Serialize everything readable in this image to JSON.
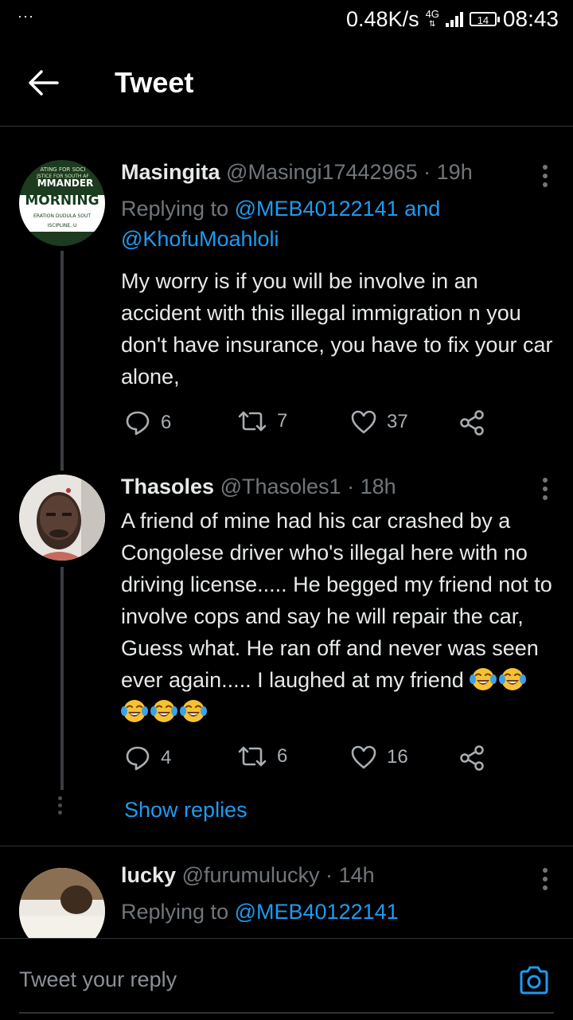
{
  "status_bar": {
    "dots": "···",
    "net_speed": "0.48K/s",
    "signal_label": "4G",
    "battery": "14",
    "time": "08:43"
  },
  "header": {
    "title": "Tweet"
  },
  "tweets": [
    {
      "name": "Masingita",
      "handle": "@Masingi17442965",
      "time": "19h",
      "replying_prefix": "Replying to",
      "replying_to": [
        "@MEB40122141",
        "@KhofuMoahloli"
      ],
      "replying_joiner": "and",
      "text": "My worry is if you will be involve in an accident with this illegal immigration n you don't have insurance, you have to fix your car alone,",
      "replies": "6",
      "retweets": "7",
      "likes": "37",
      "avatar_text": [
        "ATING FOR SOCI",
        "JSTICE FOR SOUTH AF",
        "MMANDER",
        "MORNING",
        "ERATION DUDULA SOUT",
        "ISCIPLINE, U"
      ]
    },
    {
      "name": "Thasoles",
      "handle": "@Thasoles1",
      "time": "18h",
      "text": "A friend of mine had his car crashed by a Congolese driver who's illegal here with no driving license..... He begged my friend not to involve cops and say he will repair the car, Guess what. He ran off and never was seen ever again..... I laughed at my friend",
      "emoji_count": 5,
      "replies": "4",
      "retweets": "6",
      "likes": "16"
    },
    {
      "name": "lucky",
      "handle": "@furumulucky",
      "time": "14h",
      "replying_prefix": "Replying to",
      "replying_to": [
        "@MEB40122141"
      ]
    }
  ],
  "show_replies": "Show replies",
  "compose": {
    "placeholder": "Tweet your reply"
  },
  "colors": {
    "accent": "#1d9bf0",
    "background": "#000000",
    "muted": "#71767b"
  },
  "icons": [
    "back-arrow-icon",
    "more-vertical-icon",
    "reply-icon",
    "retweet-icon",
    "like-icon",
    "share-icon",
    "camera-icon",
    "crying-laughing-emoji"
  ]
}
